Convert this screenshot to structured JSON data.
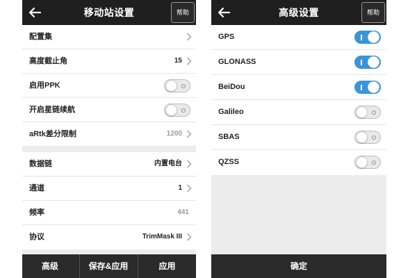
{
  "left": {
    "title": "移动站设置",
    "help_label": "帮助",
    "settings": [
      {
        "label": "配置集",
        "value": "",
        "control": "chevron"
      },
      {
        "label": "高度截止角",
        "value": "15",
        "control": "chevron"
      },
      {
        "label": "启用PPK",
        "value": "",
        "control": "toggle",
        "on": false
      },
      {
        "label": "开启星链续航",
        "value": "",
        "control": "toggle",
        "on": false
      },
      {
        "label": "aRtk差分限制",
        "value": "1200",
        "control": "chevron"
      }
    ],
    "datalink": [
      {
        "label": "数据链",
        "value": "内置电台",
        "control": "chevron"
      },
      {
        "label": "通道",
        "value": "1",
        "control": "chevron"
      },
      {
        "label": "频率",
        "value": "441",
        "control": "none"
      },
      {
        "label": "协议",
        "value": "TrimMask III",
        "control": "chevron"
      }
    ],
    "bottom_buttons": [
      "高级",
      "保存&应用",
      "应用"
    ]
  },
  "right": {
    "title": "高级设置",
    "help_label": "帮助",
    "systems": [
      {
        "label": "GPS",
        "on": true
      },
      {
        "label": "GLONASS",
        "on": true
      },
      {
        "label": "BeiDou",
        "on": true
      },
      {
        "label": "Galileo",
        "on": false
      },
      {
        "label": "SBAS",
        "on": false
      },
      {
        "label": "QZSS",
        "on": false
      }
    ],
    "confirm_label": "确定"
  },
  "colors": {
    "titlebar": "#1f1f1f",
    "toggle_on": "#3a95d8",
    "bottombar": "#2a2a2a",
    "section_gap": "#ececec"
  }
}
